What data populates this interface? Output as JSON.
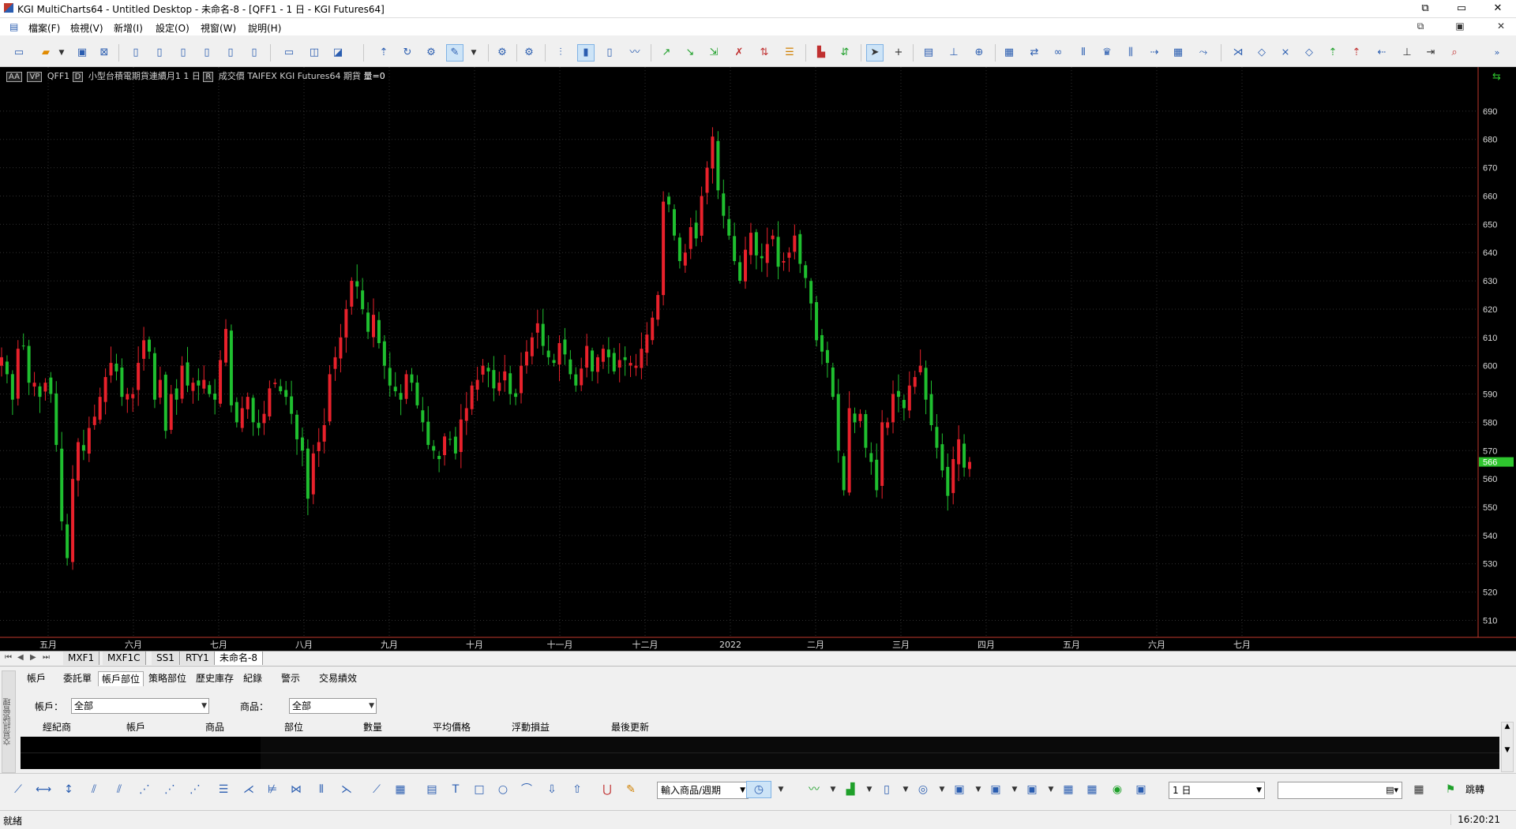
{
  "window": {
    "title": "KGI MultiCharts64 - Untitled Desktop - 未命名-8 - [QFF1 - 1 日 - KGI Futures64]",
    "controls": [
      "⧉",
      "▭",
      "✕"
    ]
  },
  "menu": {
    "items": [
      "檔案(F)",
      "檢視(V)",
      "新增(I)",
      "設定(O)",
      "視窗(W)",
      "說明(H)"
    ],
    "mdi_controls": [
      "⧉",
      "▣",
      "✕"
    ]
  },
  "chart_header": {
    "style_box": "AA",
    "vp_box": "VP",
    "symbol": "QFF1",
    "d_box": "D",
    "description": "小型台積電期貨連續月1",
    "period": "1 日",
    "r_box": "R",
    "field": "成交價",
    "exchange": "TAIFEX",
    "datafeed": "KGI Futures64",
    "category": "期貨",
    "volume": "量=0"
  },
  "sheet_tabs": {
    "nav": [
      "⏮",
      "◀",
      "▶",
      "⏭"
    ],
    "tabs": [
      "MXF1",
      "MXF1C",
      "SS1",
      "RTY1",
      "未命名-8"
    ],
    "active": 4
  },
  "order_panel": {
    "side_label": "交易訊號管理",
    "tabs": [
      "帳戶",
      "委託單",
      "帳戶部位",
      "策略部位",
      "歷史庫存",
      "紀錄",
      "警示",
      "交易績效"
    ],
    "active_tab": 2,
    "account_label": "帳戶：",
    "account_value": "全部",
    "product_label": "商品：",
    "product_value": "全部",
    "columns": [
      "經紀商",
      "帳戶",
      "商品",
      "部位",
      "數量",
      "平均價格",
      "浮動損益",
      "最後更新"
    ]
  },
  "drawing_toolbar": {
    "symbol_input_placeholder": "輸入商品/週期",
    "period_value": "1 日",
    "jump_label": "跳轉"
  },
  "status": {
    "text": "就緒",
    "time": "16:20:21"
  },
  "chart_data": {
    "type": "candlestick",
    "y_ticks": [
      510,
      520,
      530,
      540,
      550,
      560,
      570,
      580,
      590,
      600,
      610,
      620,
      630,
      640,
      650,
      660,
      670,
      680,
      690
    ],
    "ylim": [
      504,
      700
    ],
    "x_labels": [
      "五月",
      "六月",
      "七月",
      "八月",
      "九月",
      "十月",
      "十一月",
      "十二月",
      "2022",
      "二月",
      "三月",
      "四月",
      "五月",
      "六月",
      "七月"
    ],
    "last_price": "566",
    "colors": {
      "up": "#e8212b",
      "down": "#1fbf2f",
      "background": "#000000",
      "grid": "#303030",
      "axis": "#ffffff",
      "last_price": "#2ec52e"
    },
    "closes": [
      603,
      597,
      588,
      606,
      607,
      594,
      594,
      589,
      594,
      590,
      572,
      545,
      532,
      560,
      573,
      570,
      578,
      582,
      589,
      596,
      601,
      598,
      589,
      590,
      590,
      601,
      609,
      605,
      588,
      595,
      577,
      590,
      588,
      600,
      593,
      594,
      593,
      595,
      590,
      588,
      602,
      613,
      586,
      580,
      585,
      589,
      580,
      578,
      583,
      592,
      594,
      591,
      589,
      583,
      574,
      570,
      553,
      569,
      573,
      579,
      597,
      603,
      610,
      620,
      630,
      628,
      620,
      612,
      618,
      608,
      600,
      593,
      591,
      588,
      597,
      594,
      586,
      580,
      572,
      570,
      567,
      575,
      574,
      569,
      581,
      585,
      593,
      595,
      600,
      598,
      592,
      594,
      598,
      590,
      589,
      600,
      605,
      610,
      615,
      607,
      603,
      601,
      608,
      604,
      597,
      593,
      599,
      607,
      598,
      603,
      606,
      603,
      598,
      602,
      602,
      601,
      600,
      606,
      611,
      617,
      625,
      658,
      657,
      646,
      637,
      640,
      649,
      645,
      660,
      670,
      681,
      662,
      653,
      646,
      637,
      630,
      641,
      647,
      639,
      638,
      643,
      646,
      635,
      637,
      640,
      646,
      636,
      631,
      622,
      609,
      605,
      601,
      589,
      570,
      556,
      585,
      580,
      583,
      571,
      566,
      556,
      580,
      580,
      590,
      589,
      585,
      593,
      596,
      600,
      588,
      579,
      571,
      563,
      554,
      567,
      574,
      564,
      566
    ]
  }
}
